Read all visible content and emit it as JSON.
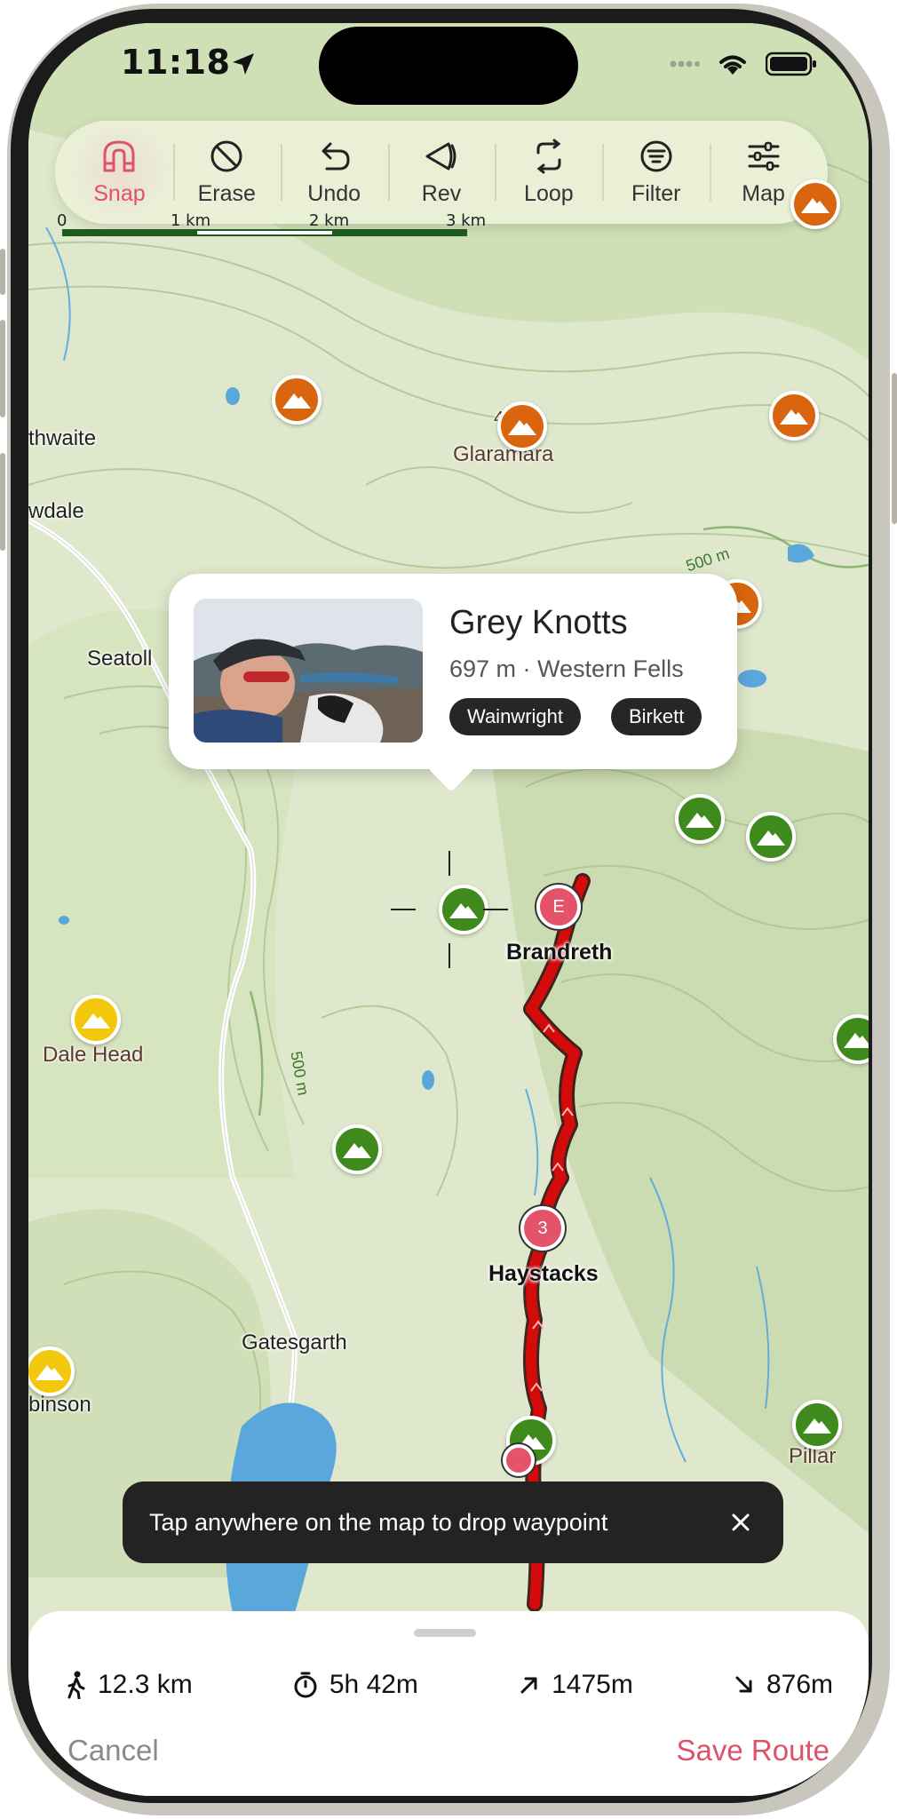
{
  "status_bar": {
    "time": "11:18"
  },
  "toolbar": {
    "items": [
      {
        "label": "Snap",
        "icon": "magnet-icon",
        "active": true
      },
      {
        "label": "Erase",
        "icon": "erase-icon",
        "active": false
      },
      {
        "label": "Undo",
        "icon": "undo-icon",
        "active": false
      },
      {
        "label": "Rev",
        "icon": "reverse-icon",
        "active": false
      },
      {
        "label": "Loop",
        "icon": "loop-icon",
        "active": false
      },
      {
        "label": "Filter",
        "icon": "filter-icon",
        "active": false
      },
      {
        "label": "Map",
        "icon": "sliders-icon",
        "active": false
      }
    ]
  },
  "scale_bar": {
    "labels": [
      "0",
      "1 km",
      "2 km",
      "3 km"
    ]
  },
  "map": {
    "places": [
      "thwaite",
      "wdale",
      "Seatoll",
      "Gatesgarth",
      "binson"
    ],
    "peak_labels": [
      "Glaramara",
      "Dale Head",
      "Pillar"
    ],
    "route_labels": [
      "Brandreth",
      "Haystacks"
    ],
    "contour_labels": [
      "500 m",
      "500 m"
    ],
    "spot_height": "4"
  },
  "callout": {
    "title": "Grey Knotts",
    "subtitle": "697 m · Western Fells",
    "tags": [
      "Wainwright",
      "Birkett"
    ]
  },
  "waypoints": [
    "E",
    "3"
  ],
  "toast": {
    "message": "Tap anywhere on the map to drop waypoint"
  },
  "sheet": {
    "stats": {
      "distance": "12.3 km",
      "time": "5h 42m",
      "ascent": "1475m",
      "descent": "876m"
    },
    "cancel_label": "Cancel",
    "save_label": "Save Route"
  },
  "colors": {
    "accent": "#e0516a",
    "route": "#d40b0b",
    "peak_orange": "#d9650f",
    "peak_green": "#3f8a1d",
    "peak_yellow": "#f2c80c",
    "map_base": "#dfe8cc",
    "water": "#5aa7dc"
  }
}
